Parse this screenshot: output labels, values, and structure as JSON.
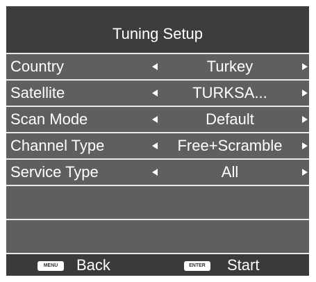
{
  "title": "Tuning Setup",
  "rows": [
    {
      "label": "Country",
      "value": "Turkey"
    },
    {
      "label": "Satellite",
      "value": "TURKSA..."
    },
    {
      "label": "Scan Mode",
      "value": "Default"
    },
    {
      "label": "Channel Type",
      "value": "Free+Scramble"
    },
    {
      "label": "Service Type",
      "value": "All"
    }
  ],
  "footer": {
    "menu_key": "MENU",
    "back_label": "Back",
    "enter_key": "ENTER",
    "start_label": "Start"
  },
  "colors": {
    "panel": "#3a3a3a",
    "row": "#5f5f5f",
    "divider": "#e8e8e8",
    "text": "#ffffff"
  }
}
